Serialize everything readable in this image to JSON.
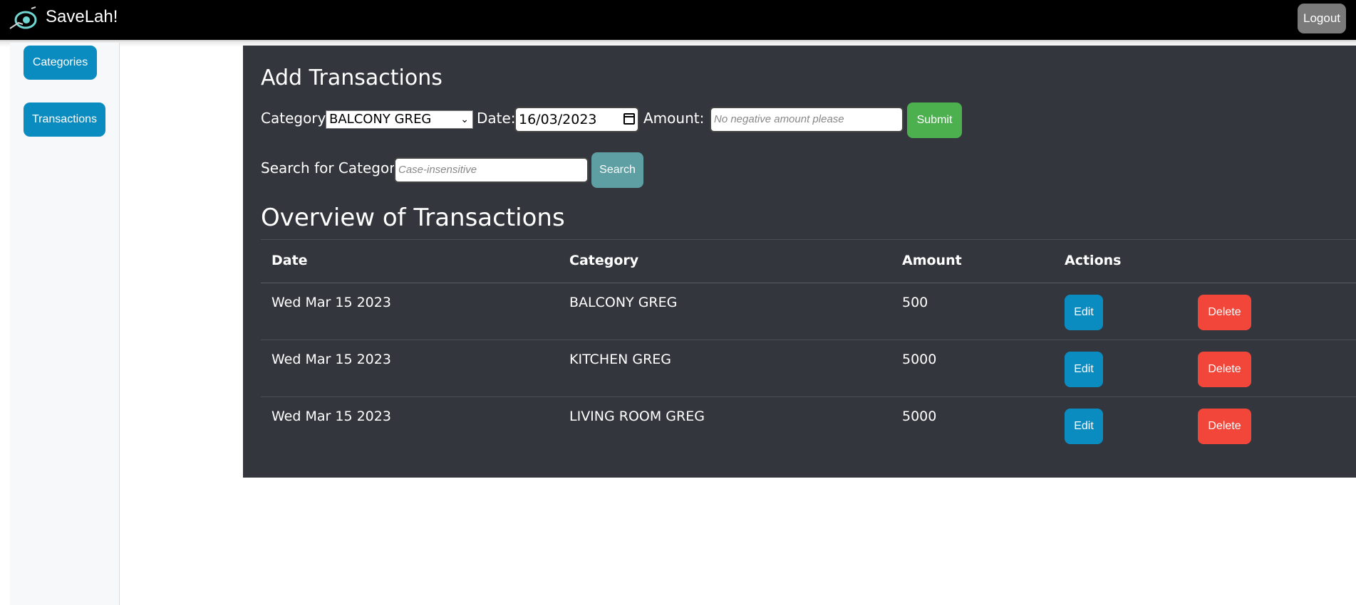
{
  "header": {
    "brand": "SaveLah!",
    "logout_label": "Logout"
  },
  "sidebar": {
    "items": [
      {
        "label": "Categories"
      },
      {
        "label": "Transactions"
      }
    ]
  },
  "form": {
    "title": "Add Transactions",
    "category_label": "Category:",
    "category_value": "BALCONY GREG",
    "date_label": "Date:",
    "date_value": "16/03/2023",
    "amount_label": "Amount: $",
    "amount_placeholder": "No negative amount please",
    "submit_label": "Submit"
  },
  "search": {
    "label": "Search for Category:",
    "placeholder": "Case-insensitive",
    "button_label": "Search"
  },
  "overview": {
    "title": "Overview of Transactions",
    "columns": [
      "Date",
      "Category",
      "Amount",
      "Actions"
    ],
    "rows": [
      {
        "date": "Wed Mar 15 2023",
        "category": "BALCONY GREG",
        "amount": "500",
        "edit": "Edit",
        "delete": "Delete"
      },
      {
        "date": "Wed Mar 15 2023",
        "category": "KITCHEN GREG",
        "amount": "5000",
        "edit": "Edit",
        "delete": "Delete"
      },
      {
        "date": "Wed Mar 15 2023",
        "category": "LIVING ROOM GREG",
        "amount": "5000",
        "edit": "Edit",
        "delete": "Delete"
      }
    ]
  },
  "colors": {
    "topbar": "#000000",
    "panel": "#33373d",
    "primary": "#0b8cc1",
    "success": "#4cb04f",
    "danger": "#f2463b",
    "search": "#5e9fa4",
    "logout": "#7a7a7a"
  }
}
